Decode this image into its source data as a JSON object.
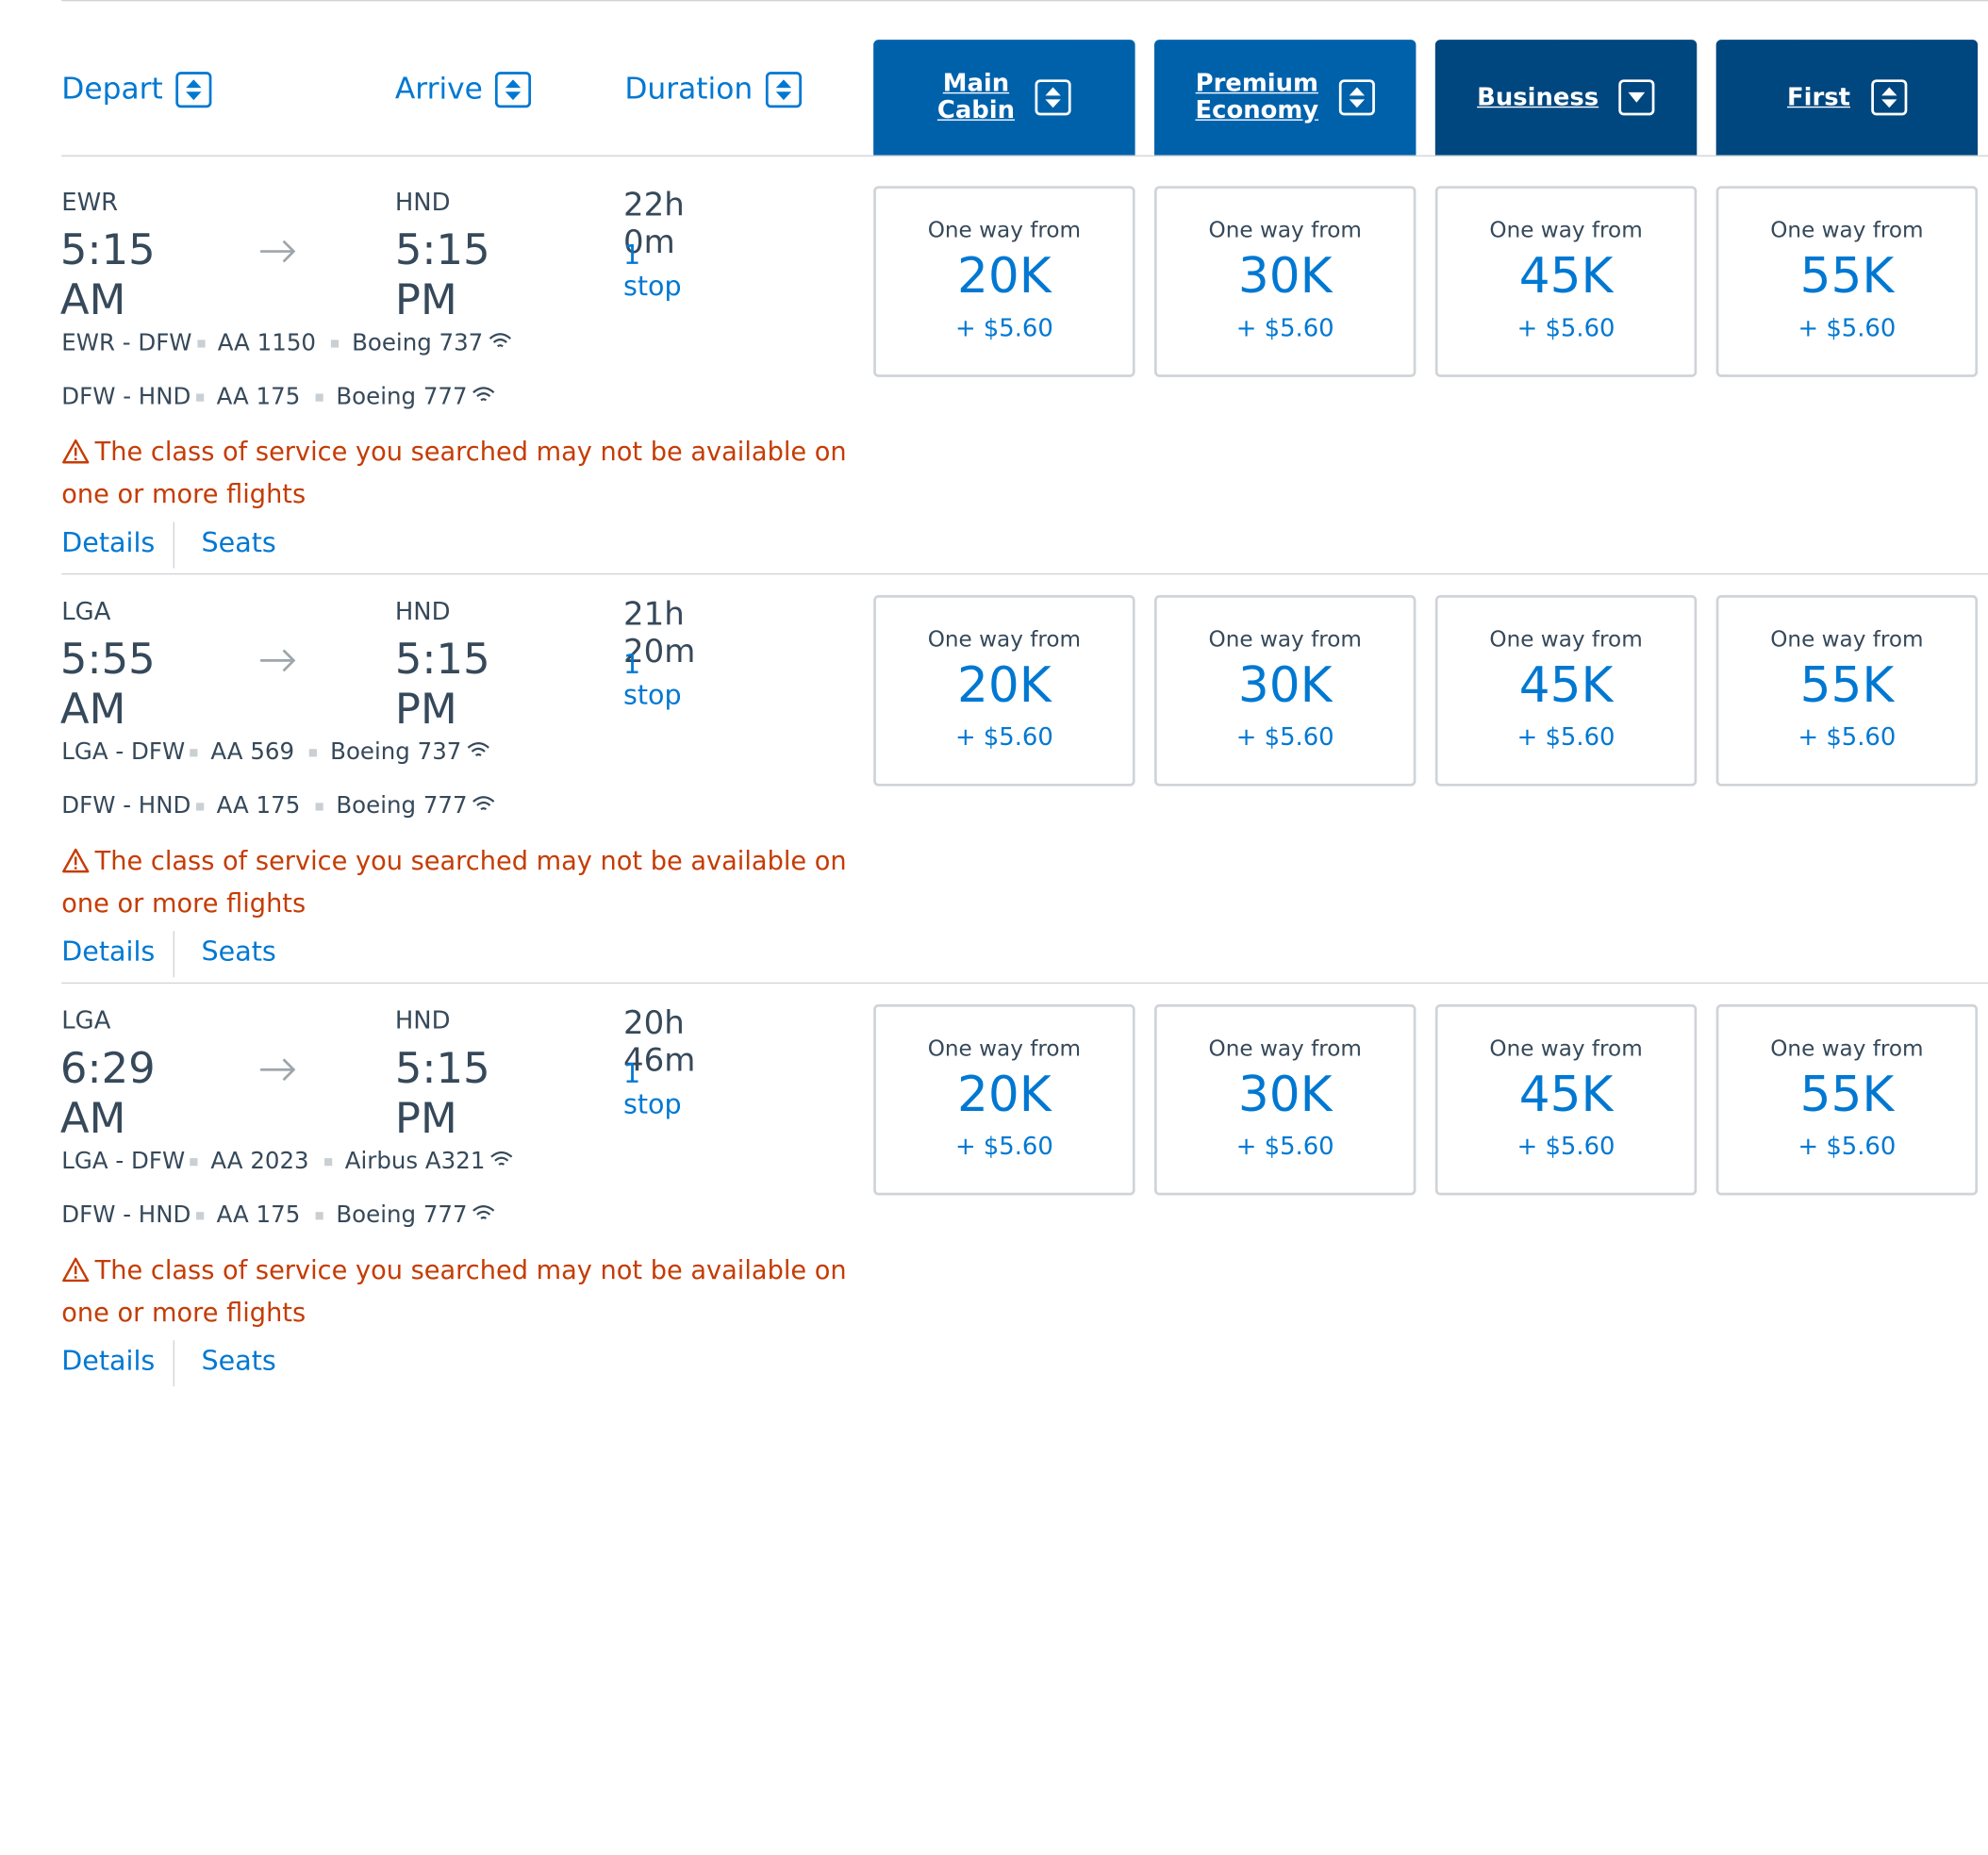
{
  "header": {
    "depart": "Depart",
    "arrive": "Arrive",
    "duration": "Duration",
    "cabins": [
      {
        "label": "Main\nCabin",
        "sort": "both",
        "color": "#0061ab"
      },
      {
        "label": "Premium\nEconomy",
        "sort": "both",
        "color": "#0061ab"
      },
      {
        "label": "Business",
        "sort": "down",
        "color": "#00467f"
      },
      {
        "label": "First",
        "sort": "both",
        "color": "#00467f"
      }
    ]
  },
  "fare_from_label": "One way from",
  "warning_text": "The class of service you searched may not be available on one or more flights",
  "details_label": "Details",
  "seats_label": "Seats",
  "flights": [
    {
      "depart_code": "EWR",
      "depart_time": "5:15 AM",
      "arrive_code": "HND",
      "arrive_time": "5:15 PM",
      "duration": "22h 0m",
      "stops": "1 stop",
      "segments": [
        {
          "route": "EWR - DFW",
          "flight": "AA 1150",
          "aircraft": "Boeing 737"
        },
        {
          "route": "DFW - HND",
          "flight": "AA 175",
          "aircraft": "Boeing 777"
        }
      ],
      "fares": [
        {
          "miles": "20K",
          "tax": "+ $5.60"
        },
        {
          "miles": "30K",
          "tax": "+ $5.60"
        },
        {
          "miles": "45K",
          "tax": "+ $5.60"
        },
        {
          "miles": "55K",
          "tax": "+ $5.60"
        }
      ]
    },
    {
      "depart_code": "LGA",
      "depart_time": "5:55 AM",
      "arrive_code": "HND",
      "arrive_time": "5:15 PM",
      "duration": "21h 20m",
      "stops": "1 stop",
      "segments": [
        {
          "route": "LGA - DFW",
          "flight": "AA 569",
          "aircraft": "Boeing 737"
        },
        {
          "route": "DFW - HND",
          "flight": "AA 175",
          "aircraft": "Boeing 777"
        }
      ],
      "fares": [
        {
          "miles": "20K",
          "tax": "+ $5.60"
        },
        {
          "miles": "30K",
          "tax": "+ $5.60"
        },
        {
          "miles": "45K",
          "tax": "+ $5.60"
        },
        {
          "miles": "55K",
          "tax": "+ $5.60"
        }
      ]
    },
    {
      "depart_code": "LGA",
      "depart_time": "6:29 AM",
      "arrive_code": "HND",
      "arrive_time": "5:15 PM",
      "duration": "20h 46m",
      "stops": "1 stop",
      "segments": [
        {
          "route": "LGA - DFW",
          "flight": "AA 2023",
          "aircraft": "Airbus A321"
        },
        {
          "route": "DFW - HND",
          "flight": "AA 175",
          "aircraft": "Boeing 777"
        }
      ],
      "fares": [
        {
          "miles": "20K",
          "tax": "+ $5.60"
        },
        {
          "miles": "30K",
          "tax": "+ $5.60"
        },
        {
          "miles": "45K",
          "tax": "+ $5.60"
        },
        {
          "miles": "55K",
          "tax": "+ $5.60"
        }
      ]
    }
  ]
}
